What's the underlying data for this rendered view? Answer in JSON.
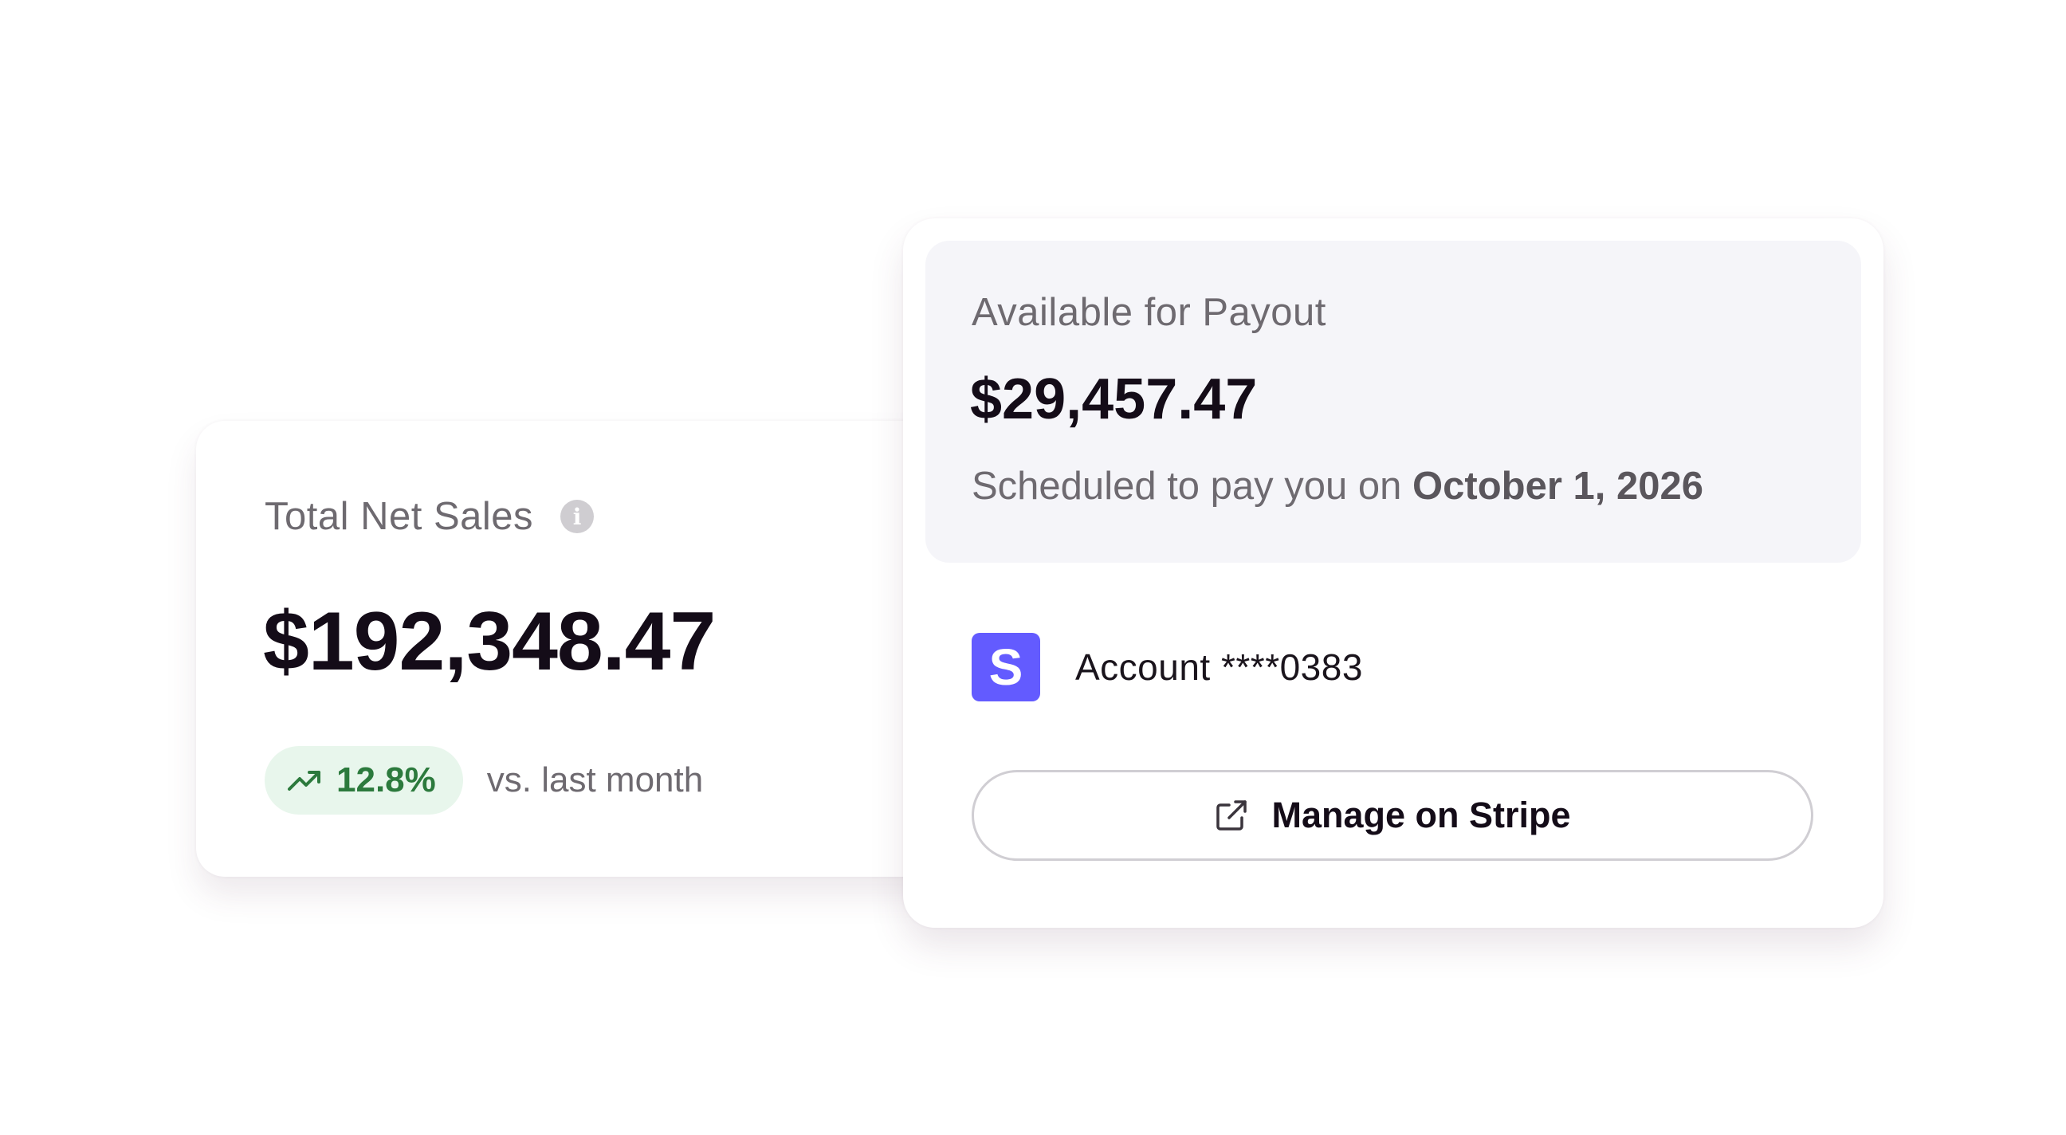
{
  "sales": {
    "title": "Total Net Sales",
    "info_icon": "info-icon",
    "amount": "$192,348.47",
    "trend": {
      "icon": "trend-up-icon",
      "value": "12.8%",
      "caption": "vs. last month",
      "color": "#2c7a3d",
      "background": "#e8f6ec"
    }
  },
  "payout": {
    "label": "Available for Payout",
    "amount": "$29,457.47",
    "schedule_prefix": "Scheduled to pay you on ",
    "schedule_date": "October 1, 2026",
    "account": {
      "logo_letter": "S",
      "logo_color": "#635bff",
      "text": "Account ****0383"
    },
    "manage_button": {
      "icon": "external-link-icon",
      "label": "Manage on Stripe"
    }
  }
}
